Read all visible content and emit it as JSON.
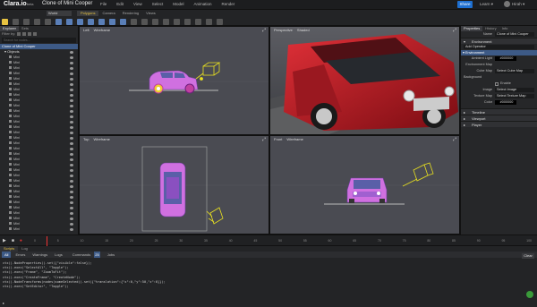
{
  "app": {
    "logo": "Clara.io",
    "logo_suffix": "beta",
    "project_title": "Clone of Mini Cooper"
  },
  "menu": [
    "File",
    "Edit",
    "View",
    "Select",
    "Model",
    "Animation",
    "Render"
  ],
  "header": {
    "share": "Share",
    "learn": "Learn ▾",
    "user": "Hirah ▾"
  },
  "toolbar": {
    "world": "World",
    "modes": [
      {
        "label": "Polygons",
        "active": true
      },
      {
        "label": "Camera",
        "active": false
      },
      {
        "label": "Rendering",
        "active": false
      },
      {
        "label": "Views",
        "active": false
      }
    ]
  },
  "left_panel": {
    "tabs": [
      {
        "label": "Explorer",
        "active": true
      },
      {
        "label": "Sets",
        "active": false
      }
    ],
    "filter_label": "Filter by:",
    "search_placeholder": "Search for nodes...",
    "root": "Clone of Mini Cooper",
    "group": "Objects",
    "items": [
      "Mini",
      "Mini",
      "Mini",
      "Mini",
      "Mini",
      "Mini",
      "Mini",
      "Mini",
      "Mini",
      "Mini",
      "Mini",
      "Mini",
      "Mini",
      "Mini",
      "Mini",
      "Mini",
      "Mini",
      "Mini",
      "Mini",
      "Mini",
      "Mini",
      "Mini",
      "Mini",
      "Mini",
      "Mini",
      "Mini",
      "Mini",
      "Mini",
      "Mini",
      "Mini",
      "Mini",
      "Mini",
      "Mini"
    ]
  },
  "viewports": {
    "tl": {
      "name": "Left",
      "mode": "Wireframe"
    },
    "tr": {
      "name": "Perspective",
      "mode": "Shaded"
    },
    "bl": {
      "name": "Top",
      "mode": "Wireframe"
    },
    "br": {
      "name": "Front",
      "mode": "Wireframe"
    }
  },
  "right_panel": {
    "tabs": [
      {
        "label": "Properties",
        "active": true
      },
      {
        "label": "History",
        "active": false
      },
      {
        "label": "Info",
        "active": false
      }
    ],
    "name_label": "Name",
    "name_value": "Clone of Mini Cooper",
    "environment_header": "Environment",
    "operator_label": "Add Operator",
    "selected_env": "Environment",
    "ambient_label": "Ambient Light",
    "ambient_value": "#000000",
    "envmap_label": "Environment Map",
    "cubemap_label": "Cube Map",
    "cubemap_value": "Select Cube Map",
    "background_label": "Background",
    "enable1": "Enable",
    "image_label": "Image",
    "image_value": "Select Image",
    "texture_label": "Texture Map",
    "texture_value": "Select Texture Map",
    "color_label": "Color",
    "color_value": "#000000",
    "sections": [
      "Timeline",
      "Viewport",
      "Player"
    ]
  },
  "timeline": {
    "ticks": [
      "0",
      "5",
      "10",
      "15",
      "20",
      "25",
      "30",
      "35",
      "40",
      "45",
      "50",
      "55",
      "60",
      "65",
      "70",
      "75",
      "80",
      "85",
      "90",
      "95",
      "100"
    ]
  },
  "console": {
    "tabs1": [
      {
        "label": "Scripts",
        "active": true
      },
      {
        "label": "Log",
        "active": false
      }
    ],
    "tabs2": [
      {
        "label": "All",
        "active": true
      },
      {
        "label": "Errors",
        "active": false
      },
      {
        "label": "Warnings",
        "active": false
      },
      {
        "label": "Logs",
        "active": false
      },
      {
        "label": "Commands",
        "active": false
      },
      {
        "label": "Jobs",
        "active": false
      }
    ],
    "commands_badge": "25",
    "clear": "Clear",
    "lines": [
      "ctx().NodeProperties().set({\"visible\":false});",
      "ctx().exec(\"SelectAll\", \"Toggle\");",
      "ctx().exec(\"Frame\", \"ZoomToFit\");",
      "ctx().exec(\"CreateFrame\", \"CreateNode\");",
      "ctx().NodeTransforms(nodes(someSelected)).set({\"translation\":{\"x\":0,\"y\":50,\"z\":0}});",
      "ctx().exec(\"SetEditor\", \"Toggle\");"
    ],
    "prompt": "▸"
  },
  "colors": {
    "accent": "#e8c341",
    "selection": "#3d5a86",
    "share": "#1e6fd0",
    "car_body": "#b01820",
    "wire_pink": "#d070e0",
    "camera_yellow": "#e8e020"
  }
}
